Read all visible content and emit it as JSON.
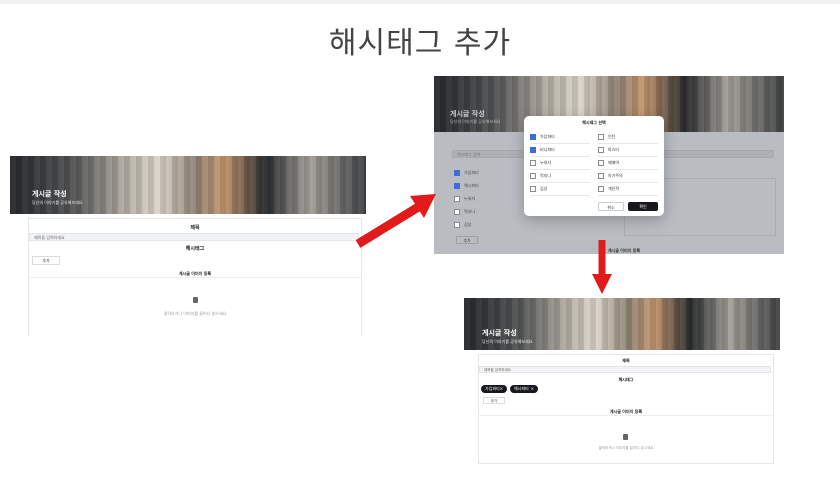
{
  "slide": {
    "title": "해시태그 추가"
  },
  "form": {
    "hero_title": "게시글 작성",
    "hero_subtitle": "당신의 이야기를 공유해보세요",
    "title_label": "제목",
    "title_placeholder": "제목을 입력하세요",
    "hashtag_label": "해시태그",
    "add_button": "추가",
    "image_label": "게시글 이미지 등록",
    "upload_hint": "클릭하거나 이미지를 끌어다 놓으세요"
  },
  "modal": {
    "title": "해시태그 선택",
    "options": [
      {
        "label": "가입파티",
        "checked": true
      },
      {
        "label": "인턴",
        "checked": false
      },
      {
        "label": "비니파티",
        "checked": true
      },
      {
        "label": "파스타",
        "checked": false
      },
      {
        "label": "누워자",
        "checked": false
      },
      {
        "label": "매매여",
        "checked": false
      },
      {
        "label": "먹지나",
        "checked": false
      },
      {
        "label": "아기주의",
        "checked": false
      },
      {
        "label": "김상",
        "checked": false
      },
      {
        "label": "개인적",
        "checked": false
      }
    ],
    "cancel": "취소",
    "confirm": "확인"
  },
  "background_list": {
    "search_placeholder": "해시태그 검색",
    "items_left": [
      {
        "label": "가입파티",
        "checked": true
      },
      {
        "label": "해시파티",
        "checked": true
      },
      {
        "label": "누워자",
        "checked": false
      },
      {
        "label": "먹지나",
        "checked": false
      },
      {
        "label": "김상",
        "checked": false
      }
    ],
    "add_button": "추가",
    "image_label": "게시글 이미지 등록"
  },
  "result": {
    "chips": [
      {
        "label": "가입파티",
        "remove": "×"
      },
      {
        "label": "해시파티",
        "remove": "×"
      }
    ],
    "add_button": "추가"
  },
  "colors": {
    "arrow": "#e11b1b",
    "chip": "#16181d",
    "confirm": "#16181d",
    "checked": "#3b6edc"
  }
}
